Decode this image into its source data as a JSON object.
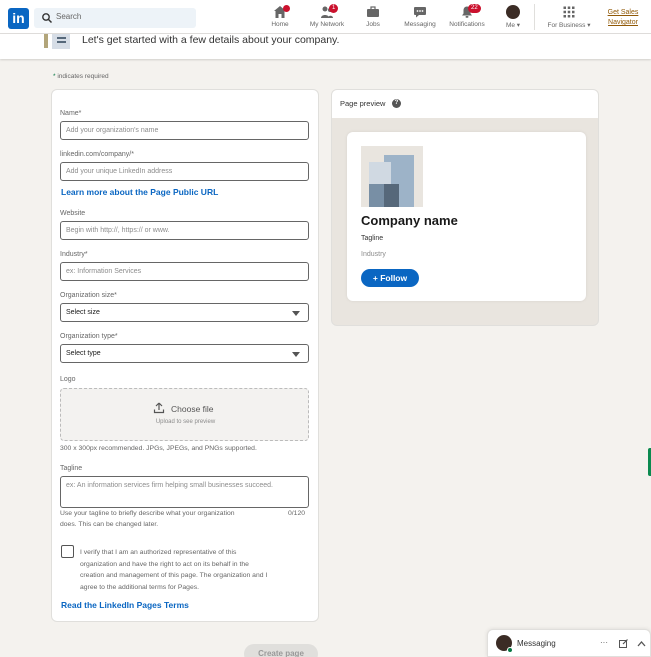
{
  "nav": {
    "search_placeholder": "Search",
    "items": [
      {
        "label": "Home"
      },
      {
        "label": "My Network",
        "badge": "1"
      },
      {
        "label": "Jobs"
      },
      {
        "label": "Messaging"
      },
      {
        "label": "Notifications",
        "badge": "22"
      },
      {
        "label": "Me"
      },
      {
        "label": "For Business"
      }
    ],
    "sales_line1": "Get Sales",
    "sales_line2": "Navigator"
  },
  "header": {
    "intro": "Let's get started with a few details about your company."
  },
  "form": {
    "required_note": "indicates required",
    "required_star": "*",
    "name_label": "Name*",
    "name_placeholder": "Add your organization's name",
    "url_label": "linkedin.com/company/*",
    "url_placeholder": "Add your unique LinkedIn address",
    "url_help_link": "Learn more about the Page Public URL",
    "website_label": "Website",
    "website_placeholder": "Begin with http://, https:// or www.",
    "industry_label": "Industry*",
    "industry_placeholder": "ex: Information Services",
    "size_label": "Organization size*",
    "size_value": "Select size",
    "type_label": "Organization type*",
    "type_value": "Select type",
    "logo_label": "Logo",
    "logo_choose": "Choose file",
    "logo_sub": "Upload to see preview",
    "logo_hint": "300 x 300px recommended. JPGs, JPEGs, and PNGs supported.",
    "tagline_label": "Tagline",
    "tagline_placeholder": "ex: An information services firm helping small businesses succeed.",
    "tagline_hint_1": "Use your tagline to briefly describe what your organization",
    "tagline_hint_2": "does. This can be changed later.",
    "tagline_counter": "0/120",
    "verify_1": "I verify that I am an authorized representative of this",
    "verify_2": "organization and have the right to act on its behalf in the",
    "verify_3": "creation and management of this page. The organization and I",
    "verify_4": "agree to the additional terms for Pages.",
    "terms_link": "Read the LinkedIn Pages Terms",
    "create_button": "Create page"
  },
  "preview": {
    "title": "Page preview",
    "help": "?",
    "company_name": "Company name",
    "tagline": "Tagline",
    "industry": "Industry",
    "follow": "+ Follow"
  },
  "messaging": {
    "label": "Messaging",
    "more": "···"
  },
  "colors": {
    "brand": "#0a66c2",
    "badge": "#cb112d",
    "online": "#057642"
  }
}
